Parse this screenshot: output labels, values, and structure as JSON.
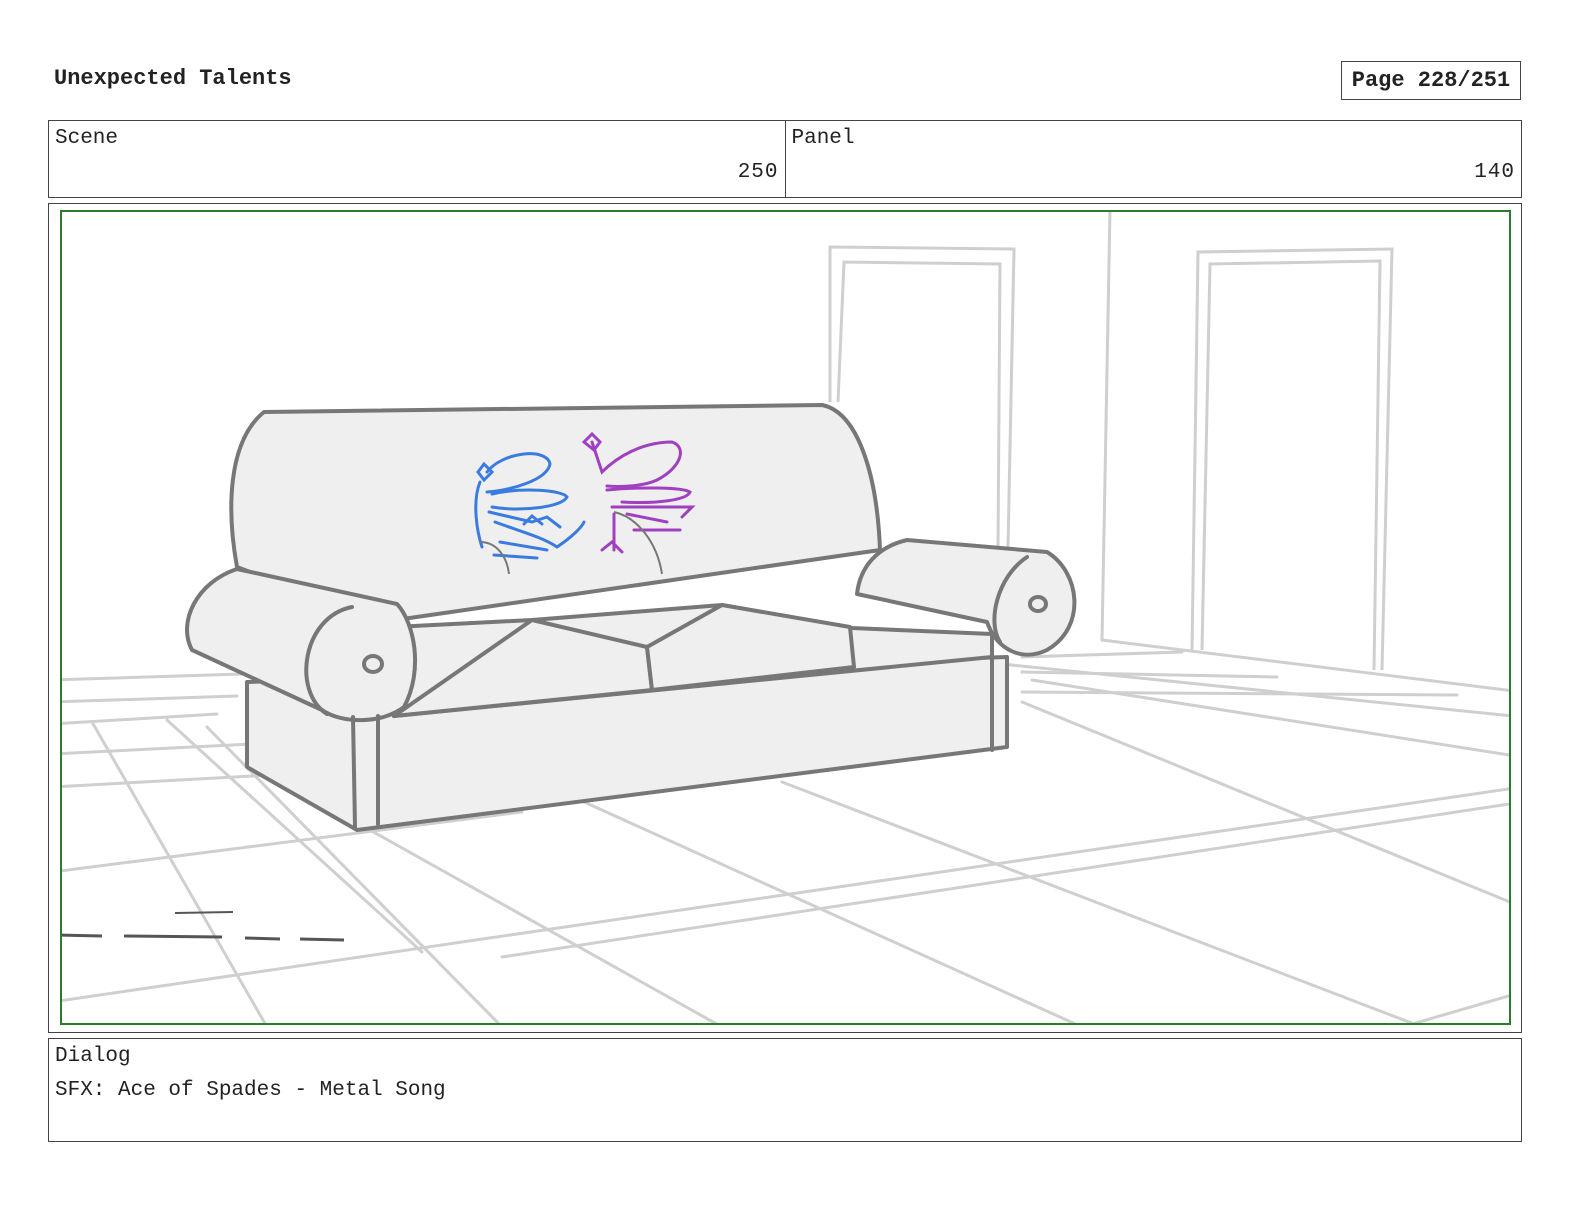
{
  "header": {
    "title": "Unexpected Talents",
    "page": "Page 228/251"
  },
  "scene": {
    "label": "Scene",
    "value": "250"
  },
  "panel": {
    "label": "Panel",
    "value": "140"
  },
  "dialog": {
    "label": "Dialog",
    "text": "SFX: Ace of Spades - Metal Song"
  },
  "colors": {
    "frame_border": "#2d7a2d",
    "sketch_gray": "#777777",
    "floor_gray": "#cccccc",
    "character_blue": "#3a7be0",
    "character_purple": "#a040c0"
  }
}
